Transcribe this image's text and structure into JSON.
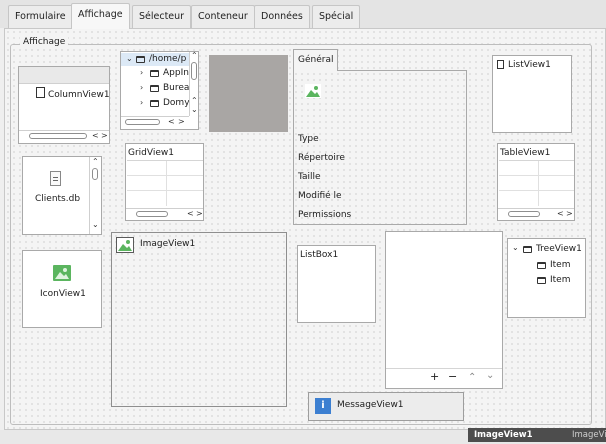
{
  "tabs": [
    "Formulaire",
    "Affichage",
    "Sélecteur",
    "Conteneur",
    "Données",
    "Spécial"
  ],
  "active_tab": "Affichage",
  "group_title": "Affichage",
  "column_view": {
    "label": "ColumnView1"
  },
  "tree_browser": {
    "root": "/home/p",
    "items": [
      "AppIn",
      "Burea",
      "Domy"
    ]
  },
  "file_icon": {
    "label": "Clients.db"
  },
  "grid_view": {
    "label": "GridView1"
  },
  "image_view": {
    "label": "ImageView1"
  },
  "icon_view": {
    "label": "IconView1"
  },
  "file_properties": {
    "tab": "Général",
    "fields": [
      "Type",
      "Répertoire",
      "Taille",
      "Modifié le",
      "Permissions"
    ]
  },
  "list_view": {
    "label": "ListView1"
  },
  "table_view": {
    "label": "TableView1"
  },
  "list_box": {
    "label": "ListBox1"
  },
  "list_editor": {
    "buttons": [
      "+",
      "−",
      "⌃",
      "⌄"
    ]
  },
  "tree_view": {
    "root": "TreeView1",
    "items": [
      "Item",
      "Item"
    ]
  },
  "message_view": {
    "label": "MessageView1"
  },
  "status": {
    "selected": "ImageView1",
    "type": "ImageVi"
  },
  "colors": {
    "selection": "#4d4d4d",
    "icon_green": "#5bb55f",
    "icon_blue": "#3c7fd1",
    "placeholder_gray": "#a9a6a4"
  }
}
